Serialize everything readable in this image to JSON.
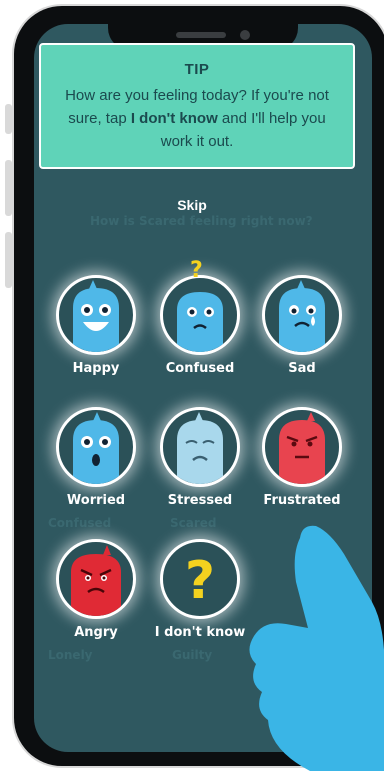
{
  "tip": {
    "title": "TIP",
    "body_part1": "How are you feeling today? If you're not sure, tap",
    "body_bold": "I don't know",
    "body_part2": "and I'll help you work it out."
  },
  "skip_label": "Skip",
  "background_prompt": "How is Scared feeling right now?",
  "moods": [
    {
      "label": "Happy",
      "color": "#4fb8e8"
    },
    {
      "label": "Confused",
      "color": "#4fb8e8"
    },
    {
      "label": "Sad",
      "color": "#4fb8e8"
    },
    {
      "label": "Worried",
      "color": "#4fb8e8"
    },
    {
      "label": "Stressed",
      "color": "#a9d8ec"
    },
    {
      "label": "Frustrated",
      "color": "#e8444f"
    },
    {
      "label": "Angry",
      "color": "#e02a35"
    },
    {
      "label": "I don't know",
      "color": "#f4d21f"
    }
  ],
  "ghost_labels": [
    "Confused",
    "Scared",
    "Lonely",
    "Guilty"
  ],
  "colors": {
    "screen": "#2f5860",
    "tip": "#5fd3b8",
    "hand": "#3ab5e6"
  }
}
